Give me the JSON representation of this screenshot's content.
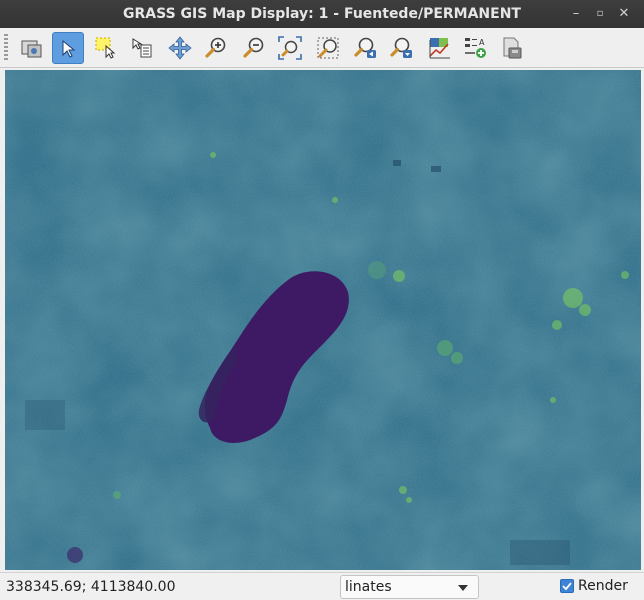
{
  "window": {
    "title": "GRASS GIS Map Display: 1  - Fuentede/PERMANENT",
    "controls": [
      "minimize-icon",
      "maximize-icon",
      "close-icon"
    ]
  },
  "toolbar": {
    "tools": [
      {
        "name": "display-map-icon",
        "active": false
      },
      {
        "name": "pointer-icon",
        "active": true
      },
      {
        "name": "select-features-icon",
        "active": false
      },
      {
        "name": "query-icon",
        "active": false
      },
      {
        "name": "pan-icon",
        "active": false
      },
      {
        "name": "zoom-in-icon",
        "active": false
      },
      {
        "name": "zoom-out-icon",
        "active": false
      },
      {
        "name": "zoom-extent-icon",
        "active": false
      },
      {
        "name": "zoom-region-icon",
        "active": false
      },
      {
        "name": "zoom-back-icon",
        "active": false
      },
      {
        "name": "zoom-options-icon",
        "active": false
      },
      {
        "name": "analyze-icon",
        "active": false
      },
      {
        "name": "overlay-legend-icon",
        "active": false
      },
      {
        "name": "save-map-icon",
        "active": false
      }
    ]
  },
  "map": {
    "layer_colors": {
      "base": "#2c6a86",
      "water_body": "#3d1a63",
      "bright_patches": "#7fd15a",
      "dark_patches": "#264f6b"
    }
  },
  "statusbar": {
    "coordinates": "338345.69; 4113840.00",
    "display_mode": "linates",
    "render_label": "Render",
    "render_checked": true
  }
}
